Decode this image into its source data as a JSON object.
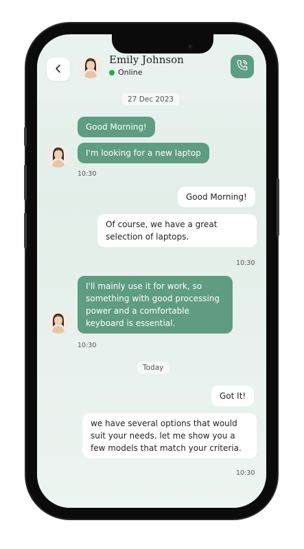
{
  "header": {
    "contact_name": "Emily Johnson",
    "status": "Online"
  },
  "chat": {
    "date_divider_1": "27 Dec 2023",
    "date_divider_2": "Today",
    "messages": [
      {
        "side": "incoming",
        "text": "Good Morning!"
      },
      {
        "side": "incoming",
        "text": "I'm looking for a new laptop",
        "time": "10:30"
      },
      {
        "side": "outgoing",
        "text": "Good Morning!"
      },
      {
        "side": "outgoing",
        "text": "Of course, we have a great selection of laptops.",
        "time": "10:30"
      },
      {
        "side": "incoming",
        "text": "I'll mainly use it for work, so something with good processing power and a comfortable keyboard is essential.",
        "time": "10:30"
      },
      {
        "side": "outgoing",
        "text": "Got It!"
      },
      {
        "side": "outgoing",
        "text": "we have several options that would suit your needs. let me show you a few models that match your criteria.",
        "time": "10:30"
      }
    ]
  },
  "colors": {
    "accent": "#5f9c82",
    "online": "#1fae4a",
    "background": "#e6f0ec"
  },
  "icons": {
    "back": "chevron-left-icon",
    "call": "phone-call-icon"
  }
}
